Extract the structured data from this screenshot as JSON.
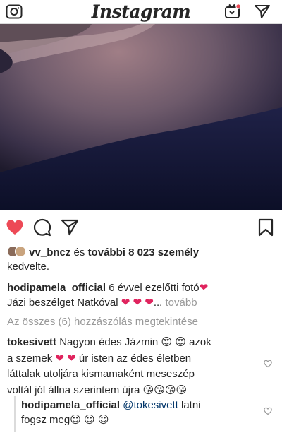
{
  "header": {
    "logo": "Instagram",
    "icons": {
      "left": "camera-icon",
      "tv": "igtv-icon",
      "direct": "paper-plane-icon"
    }
  },
  "photo": {
    "description_icon": "photo-belly"
  },
  "actions": {
    "like": "heart-filled-icon",
    "comment": "comment-bubble-icon",
    "share": "paper-plane-icon",
    "save": "bookmark-icon",
    "like_color": "#ed4956"
  },
  "likes": {
    "user": "vv_bncz",
    "and": " és ",
    "others": "további 8 023 személy",
    "liked": "kedvelte."
  },
  "caption": {
    "user": "hodipamela_official",
    "text1": " 6 évvel ezelőtti fotó",
    "text2": "Jázi beszélget Natkóval ",
    "ellipsis": "...",
    "more": "tovább"
  },
  "view_all": "Az összes (6) hozzászólás megtekintése",
  "comments": [
    {
      "user": "tokesivett",
      "text_a": " Nagyon édes Jázmin ",
      "text_b": " azok",
      "text_c": "a szemek ",
      "text_d": " úr isten az édes életben",
      "text_e": "láttalak utoljára kismamaként meseszép",
      "text_f": "voltál jól állna szerintem újra "
    },
    {
      "user": "hodipamela_official",
      "mention": "@tokesivett",
      "text_a": " latni",
      "text_b": "fogsz meg"
    }
  ]
}
